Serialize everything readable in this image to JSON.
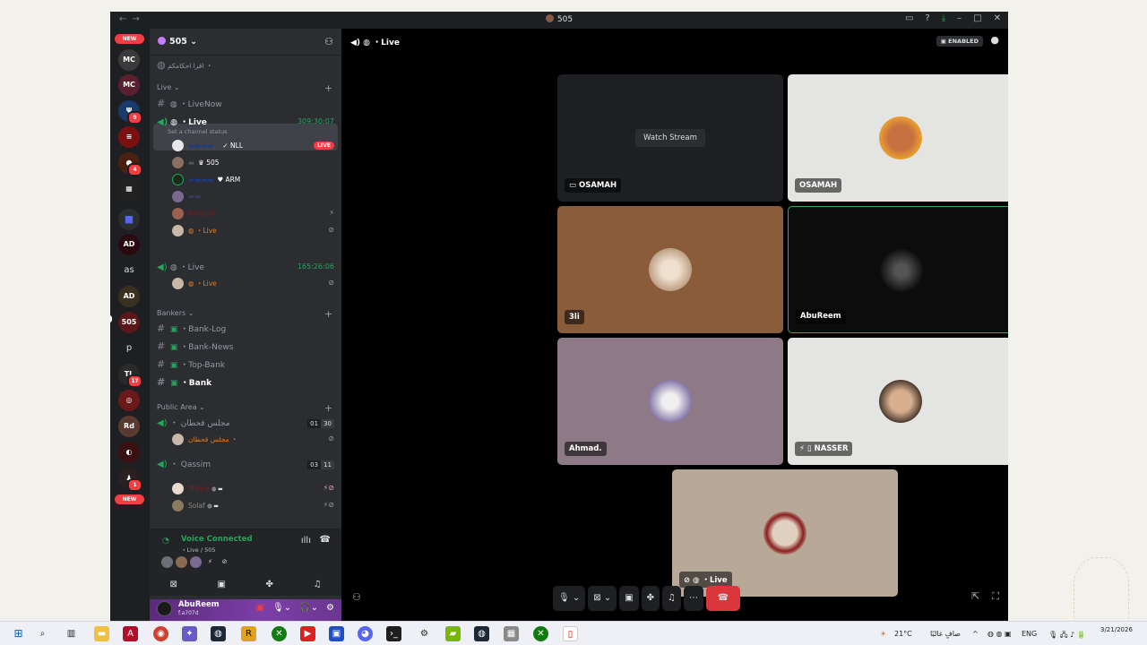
{
  "window": {
    "title": "505"
  },
  "server": {
    "name": "505",
    "channel_hint": "اقرا احكامكم ・"
  },
  "rail": {
    "new_label": "NEW",
    "as_label": "as",
    "p_label": "p",
    "new_label_2": "NEW",
    "badges": [
      "9",
      "4",
      "17",
      "1",
      "29"
    ]
  },
  "categories": {
    "live": "Live",
    "bankers": "Bankers",
    "public": "Public Area"
  },
  "channels": {
    "livenow": "・LiveNow",
    "live_active": "・Live",
    "live_active_timer": "309:30:07",
    "channel_status": "Set a channel status",
    "live2": "・Live",
    "live2_timer": "165:26:06",
    "bank_log": "・Bank-Log",
    "bank_news": "・Bank-News",
    "top_bank": "・Top-Bank",
    "bank": "・Bank",
    "majlis": "・ مجلس قحطان",
    "majlis_counts": [
      "01",
      "30"
    ],
    "qassim": "・ Qassim",
    "qassim_counts": [
      "03",
      "11"
    ]
  },
  "voice_users": [
    {
      "name": "NLL",
      "live": "LIVE"
    },
    {
      "name": "505"
    },
    {
      "name": "ARM"
    },
    {
      "name": ""
    },
    {
      "name": "NASSER"
    },
    {
      "name": "・Live"
    }
  ],
  "live2_user": "・Live",
  "majlis_user": "مجلس قحطان ・",
  "qassim_users": [
    "Mohra",
    "Solaf"
  ],
  "voice_panel": {
    "title": "Voice Connected",
    "sub": "・Live / 505"
  },
  "user": {
    "name": "AbuReem",
    "status": "f.a707d"
  },
  "stage": {
    "title": "・Live",
    "enabled": "ENABLED",
    "watch_stream": "Watch Stream",
    "tiles": [
      "OSAMAH",
      "OSAMAH",
      "3li",
      "AbuReem",
      "Ahmad.",
      "NASSER",
      "・Live"
    ]
  },
  "taskbar": {
    "weather": "21°C",
    "weather_text": "صافٍ غالبًا",
    "lang": "ENG",
    "date": "3/21/2026"
  }
}
